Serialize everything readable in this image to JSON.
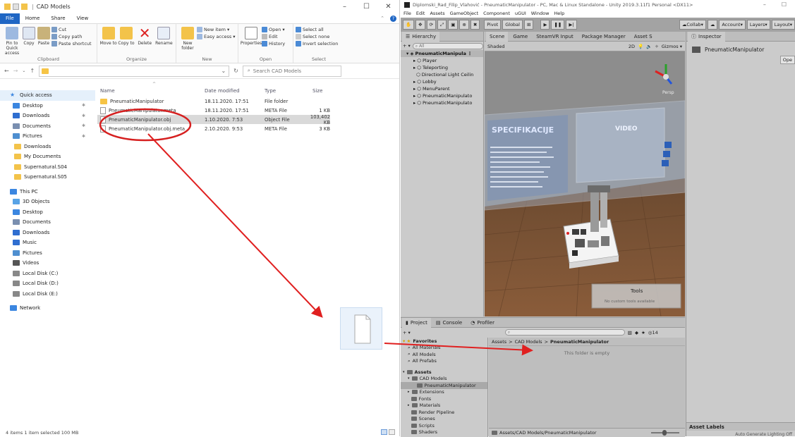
{
  "explorer": {
    "title": "CAD Models",
    "tabs": [
      "File",
      "Home",
      "Share",
      "View"
    ],
    "ribbon": {
      "clipboard": {
        "pin": "Pin to Quick access",
        "copy": "Copy",
        "paste": "Paste",
        "cut": "Cut",
        "copy_path": "Copy path",
        "paste_shortcut": "Paste shortcut",
        "label": "Clipboard"
      },
      "organize": {
        "move_to": "Move to",
        "copy_to": "Copy to",
        "delete": "Delete",
        "rename": "Rename",
        "label": "Organize"
      },
      "new": {
        "new_folder": "New folder",
        "new_item": "New item",
        "easy_access": "Easy access",
        "label": "New"
      },
      "open": {
        "properties": "Properties",
        "open": "Open",
        "edit": "Edit",
        "history": "History",
        "label": "Open"
      },
      "select": {
        "select_all": "Select all",
        "select_none": "Select none",
        "invert": "Invert selection",
        "label": "Select"
      }
    },
    "search_placeholder": "Search CAD Models",
    "nav": [
      {
        "label": "Quick access",
        "type": "star"
      },
      {
        "label": "Desktop",
        "type": "blue",
        "pin": true
      },
      {
        "label": "Downloads",
        "type": "down",
        "pin": true
      },
      {
        "label": "Documents",
        "type": "doc",
        "pin": true
      },
      {
        "label": "Pictures",
        "type": "pic",
        "pin": true
      },
      {
        "label": "Downloads",
        "type": "folder"
      },
      {
        "label": "My Documents",
        "type": "folder"
      },
      {
        "label": "Supernatural.S04",
        "type": "folder"
      },
      {
        "label": "Supernatural.S05",
        "type": "folder"
      },
      {
        "label": "This PC",
        "type": "pc"
      },
      {
        "label": "3D Objects",
        "type": "3d"
      },
      {
        "label": "Desktop",
        "type": "blue"
      },
      {
        "label": "Documents",
        "type": "doc"
      },
      {
        "label": "Downloads",
        "type": "down"
      },
      {
        "label": "Music",
        "type": "music"
      },
      {
        "label": "Pictures",
        "type": "pic"
      },
      {
        "label": "Videos",
        "type": "vid"
      },
      {
        "label": "Local Disk (C:)",
        "type": "disk"
      },
      {
        "label": "Local Disk (D:)",
        "type": "disk"
      },
      {
        "label": "Local Disk (E:)",
        "type": "disk"
      },
      {
        "label": "Network",
        "type": "net"
      }
    ],
    "columns": [
      "Name",
      "Date modified",
      "Type",
      "Size"
    ],
    "files": [
      {
        "name": "PneumaticManipulator",
        "date": "18.11.2020. 17:51",
        "type": "File folder",
        "size": "",
        "kind": "folder"
      },
      {
        "name": "PneumaticManipulator.meta",
        "date": "18.11.2020. 17:51",
        "type": "META File",
        "size": "1 KB",
        "kind": "file"
      },
      {
        "name": "PneumaticManipulator.obj",
        "date": "1.10.2020. 7:53",
        "type": "Object File",
        "size": "103,402 KB",
        "kind": "file",
        "selected": true
      },
      {
        "name": "PneumaticManipulator.obj.meta",
        "date": "2.10.2020. 9:53",
        "type": "META File",
        "size": "3 KB",
        "kind": "file"
      }
    ],
    "status": "4 items    1 item selected  100 MB"
  },
  "unity": {
    "title": "Diplomski_Rad_Filip_Vlahović - PneumaticManipulator - PC, Mac & Linux Standalone - Unity 2019.3.11f1 Personal <DX11>",
    "menu": [
      "File",
      "Edit",
      "Assets",
      "GameObject",
      "Component",
      "uGUI",
      "Window",
      "Help"
    ],
    "toolbar": {
      "pivot": "Pivot",
      "global": "Global",
      "collab": "Collab",
      "account": "Account",
      "layers": "Layers",
      "layout": "Layout"
    },
    "hierarchy": {
      "tab": "Hierarchy",
      "search": "All",
      "root": "PneumaticManipula",
      "items": [
        "Player",
        "Teleporting",
        "Directional Light Ceilin",
        "Lobby",
        "MenuParent",
        "PneumaticManipulato",
        "PneumaticManipulato"
      ]
    },
    "scene": {
      "tabs": [
        "Scene",
        "Game",
        "SteamVR Input",
        "Package Manager",
        "Asset S"
      ],
      "shading": "Shaded",
      "gizmos": "Gizmos",
      "spec_title": "SPECIFIKACIJE",
      "video_title": "VIDEO",
      "persp": "Persp",
      "tools_title": "Tools",
      "tools_sub": "No custom tools available"
    },
    "inspector": {
      "tab": "Inspector",
      "object": "PneumaticManipulator",
      "open": "Ope",
      "asset_labels": "Asset Labels",
      "footer": "Auto Generate Lighting Off"
    },
    "project": {
      "tabs": [
        "Project",
        "Console",
        "Profiler"
      ],
      "count": "14",
      "breadcrumb": [
        "Assets",
        "CAD Models",
        "PneumaticManipulator"
      ],
      "empty": "This folder is empty",
      "path": "Assets/CAD Models/PneumaticManipulator",
      "favorites": [
        "Favorites",
        "All Materials",
        "All Models",
        "All Prefabs"
      ],
      "assets": [
        "Assets",
        "CAD Models",
        "PneumaticManipulator",
        "Extensions",
        "Fonts",
        "Materials",
        "Render Pipeline",
        "Scenes",
        "Scripts",
        "Shaders"
      ]
    }
  },
  "colors": {
    "accent": "#1f66c4",
    "arrow": "#e02020",
    "annot": "#d62020",
    "unity_bg": "#c2c2c2"
  }
}
